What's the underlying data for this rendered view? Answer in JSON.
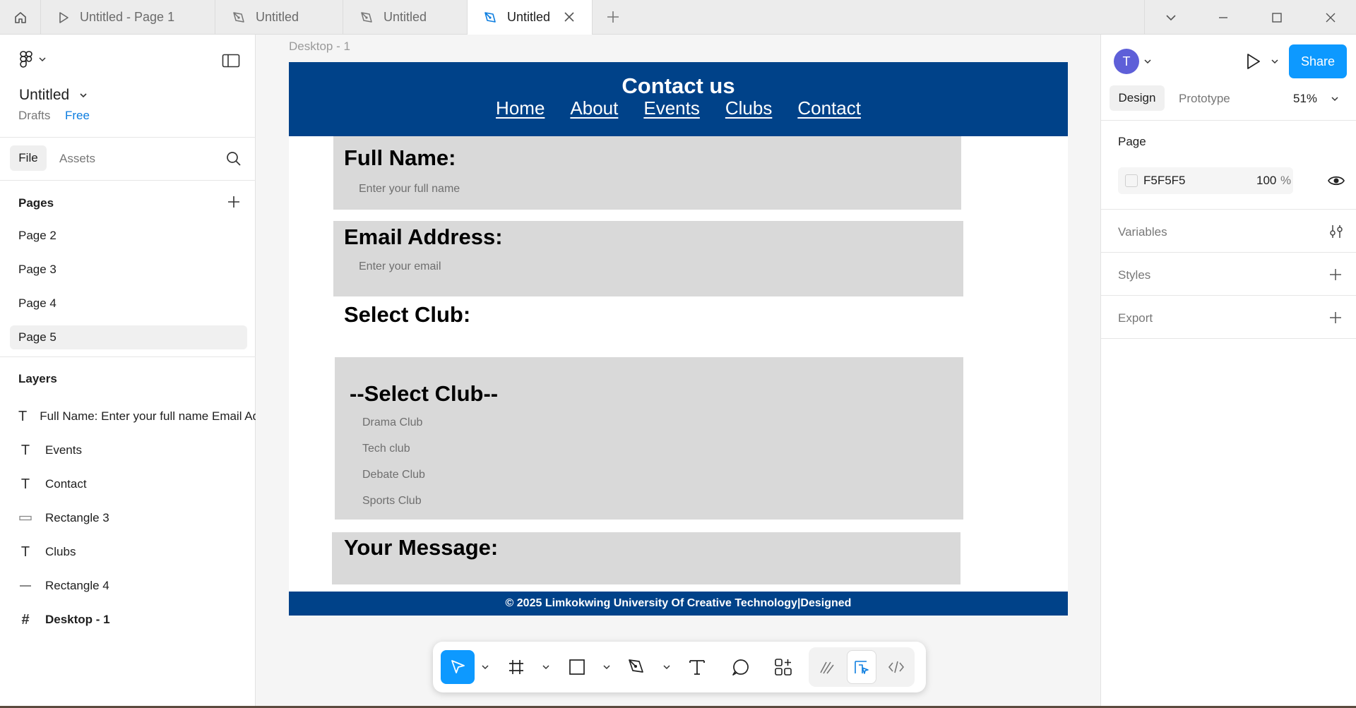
{
  "tabs": [
    {
      "label": "Untitled - Page 1",
      "icon": "play-icon"
    },
    {
      "label": "Untitled",
      "icon": "figma-pen-icon"
    },
    {
      "label": "Untitled",
      "icon": "figma-pen-icon"
    },
    {
      "label": "Untitled",
      "icon": "figma-pen-icon",
      "active": true
    }
  ],
  "file": {
    "name": "Untitled",
    "location": "Drafts",
    "plan": "Free"
  },
  "left_tabs": {
    "file": "File",
    "assets": "Assets"
  },
  "pages": {
    "title": "Pages",
    "items": [
      "Page 2",
      "Page 3",
      "Page 4",
      "Page 5"
    ],
    "selected": "Page 5"
  },
  "layers": {
    "title": "Layers",
    "items": [
      {
        "type": "text",
        "name": "Full Name: Enter your full name Email Address: Enter your email Select Club: --Select Club-- Drama Club Tech club Debate Club Sports Club Your Message:"
      },
      {
        "type": "text",
        "name": "Events"
      },
      {
        "type": "text",
        "name": "Contact"
      },
      {
        "type": "rectangle",
        "name": "Rectangle 3"
      },
      {
        "type": "text",
        "name": "Clubs"
      },
      {
        "type": "line",
        "name": "Rectangle 4"
      },
      {
        "type": "frame",
        "name": "Desktop - 1"
      }
    ]
  },
  "right": {
    "avatar_initial": "T",
    "share_label": "Share",
    "design_tab": "Design",
    "prototype_tab": "Prototype",
    "zoom": "51%",
    "page_section": "Page",
    "page_color": "F5F5F5",
    "page_opacity": "100",
    "percent_sign": "%",
    "variables": "Variables",
    "styles": "Styles",
    "export": "Export"
  },
  "canvas": {
    "frame_label": "Desktop - 1",
    "header_title": "Contact us",
    "nav": [
      "Home",
      "About",
      "Events",
      "Clubs",
      "Contact"
    ],
    "full_name_label": "Full Name:",
    "full_name_placeholder": "Enter your full name",
    "email_label": "Email Address:",
    "email_placeholder": "Enter your email",
    "club_label": "Select Club:",
    "club_default": "--Select Club--",
    "club_options": [
      "Drama Club",
      "Tech club",
      "Debate Club",
      "Sports Club"
    ],
    "message_label": "Your Message:",
    "footer": "© 2025 Limkokwing University Of Creative Technology|Designed"
  },
  "colors": {
    "accent": "#0d99ff",
    "brand_blue": "#004289",
    "field_gray": "#d9d9d9",
    "canvas_bg": "#f5f5f5"
  },
  "help_label": "?"
}
